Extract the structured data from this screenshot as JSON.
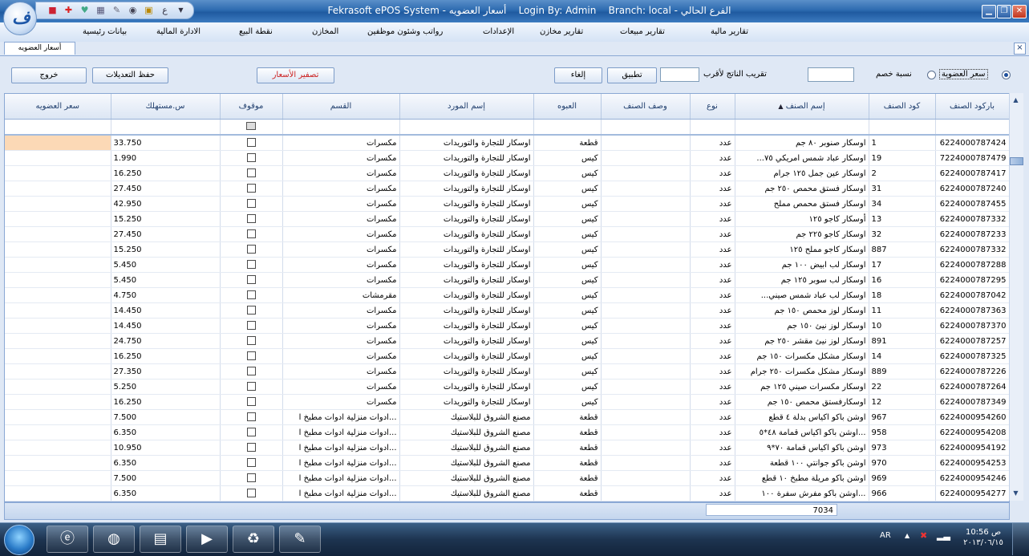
{
  "window": {
    "title": "Fekrasoft ePOS System - أسعار العضويه",
    "login": "Login By: Admin",
    "branch": "Branch: local - الفرع الحالي",
    "logo_text": "ف"
  },
  "quick_icons": [
    "apps-icon",
    "pin-icon",
    "hearts-icon",
    "calculator-icon",
    "notepad-icon",
    "eye-icon",
    "lock-icon",
    "language-icon",
    "dropdown-icon"
  ],
  "menu": [
    "تقارير مالية",
    "تقارير مبيعات",
    "تقارير مخازن",
    "الإعدادات",
    "رواتب وشئون موظفين",
    "المخازن",
    "نقطة البيع",
    "الادارة المالية",
    "بيانات رئيسية"
  ],
  "tab": {
    "label": "أسعار العضويه",
    "close": "×"
  },
  "toolbar": {
    "exit": "خروج",
    "save": "حفظ التعديلات",
    "reset": "تصفير الأسعار",
    "cancel": "إلغاء",
    "apply": "تطبيق",
    "round_label": "تقريب الناتج لأقرب",
    "discount_label": "نسبة خصم",
    "member_price_label": "سعر العضوية"
  },
  "columns": [
    "باركود الصنف",
    "كود الصنف",
    "إسم الصنف",
    "نوع",
    "وصف الصنف",
    "العبوه",
    "إسم المورد",
    "القسم",
    "موقوف",
    "س.مستهلك",
    "سعر العضويه"
  ],
  "rows": [
    [
      "6224000787424",
      "1",
      "اوسكار صنوبر ٨٠ جم",
      "عدد",
      "",
      "قطعة",
      "اوسكار للتجارة والتوريدات",
      "مكسرات",
      "33.750"
    ],
    [
      "7224000787479",
      "19",
      "اوسكار عباد شمس امريكي ٧٥...",
      "عدد",
      "",
      "كيس",
      "اوسكار للتجارة والتوريدات",
      "مكسرات",
      "1.990"
    ],
    [
      "6224000787417",
      "2",
      "اوسكار عين جمل ١٢٥ جرام",
      "عدد",
      "",
      "كيس",
      "اوسكار للتجارة والتوريدات",
      "مكسرات",
      "16.250"
    ],
    [
      "6224000787240",
      "31",
      "اوسكار فستق محمص ٢٥٠ جم",
      "عدد",
      "",
      "كيس",
      "اوسكار للتجارة والتوريدات",
      "مكسرات",
      "27.450"
    ],
    [
      "6224000787455",
      "34",
      "اوسكار فستق محمص مملح",
      "عدد",
      "",
      "كيس",
      "اوسكار للتجارة والتوريدات",
      "مكسرات",
      "42.950"
    ],
    [
      "6224000787332",
      "13",
      "أوسكار كاجو ١٢٥",
      "عدد",
      "",
      "كيس",
      "اوسكار للتجارة والتوريدات",
      "مكسرات",
      "15.250"
    ],
    [
      "6224000787233",
      "32",
      "اوسكار كاجو ٢٢٥ جم",
      "عدد",
      "",
      "كيس",
      "اوسكار للتجارة والتوريدات",
      "مكسرات",
      "27.450"
    ],
    [
      "6224000787332",
      "887",
      "اوسكار كاجو مملح ١٢٥",
      "عدد",
      "",
      "كيس",
      "اوسكار للتجارة والتوريدات",
      "مكسرات",
      "15.250"
    ],
    [
      "6224000787288",
      "17",
      "اوسكار لب ابيض ١٠٠ جم",
      "عدد",
      "",
      "كيس",
      "اوسكار للتجارة والتوريدات",
      "مكسرات",
      "5.450"
    ],
    [
      "6224000787295",
      "16",
      "اوسكار لب سوبر ١٢٥ جم",
      "عدد",
      "",
      "كيس",
      "اوسكار للتجارة والتوريدات",
      "مكسرات",
      "5.450"
    ],
    [
      "6224000787042",
      "18",
      "اوسكار لب عباد شمس صيني...",
      "عدد",
      "",
      "كيس",
      "اوسكار للتجارة والتوريدات",
      "مقرمشات",
      "4.750"
    ],
    [
      "6224000787363",
      "11",
      "اوسكار لوز محمص ١٥٠ جم",
      "عدد",
      "",
      "كيس",
      "اوسكار للتجارة والتوريدات",
      "مكسرات",
      "14.450"
    ],
    [
      "6224000787370",
      "10",
      "اوسكار لوز نيئ ١٥٠ جم",
      "عدد",
      "",
      "كيس",
      "اوسكار للتجارة والتوريدات",
      "مكسرات",
      "14.450"
    ],
    [
      "6224000787257",
      "891",
      "اوسكار لوز نيئ مقشر ٢٥٠ جم",
      "عدد",
      "",
      "كيس",
      "اوسكار للتجارة والتوريدات",
      "مكسرات",
      "24.750"
    ],
    [
      "6224000787325",
      "14",
      "اوسكار مشكل مكسرات ١٥٠ جم",
      "عدد",
      "",
      "كيس",
      "اوسكار للتجارة والتوريدات",
      "مكسرات",
      "16.250"
    ],
    [
      "6224000787226",
      "889",
      "اوسكار مشكل مكسرات ٢٥٠ جرام",
      "عدد",
      "",
      "كيس",
      "اوسكار للتجارة والتوريدات",
      "مكسرات",
      "27.350"
    ],
    [
      "6224000787264",
      "22",
      "اوسكار مكسرات صيني ١٢٥ جم",
      "عدد",
      "",
      "كيس",
      "اوسكار للتجارة والتوريدات",
      "مكسرات",
      "5.250"
    ],
    [
      "6224000787349",
      "12",
      "اوسكارفستق محمص ١٥٠ جم",
      "عدد",
      "",
      "كيس",
      "اوسكار للتجارة والتوريدات",
      "مكسرات",
      "16.250"
    ],
    [
      "6224000954260",
      "967",
      "اوشن باكو اكياس بدلة ٤ قطع",
      "عدد",
      "",
      "قطعة",
      "مصنع الشروق للبلاستيك",
      "...ادوات منزلية ادوات مطبخ ا",
      "7.500"
    ],
    [
      "6224000954208",
      "958",
      "...اوشن باكو اكياس قمامة ٤٨*٥",
      "عدد",
      "",
      "قطعة",
      "مصنع الشروق للبلاستيك",
      "...ادوات منزلية ادوات مطبخ ا",
      "6.350"
    ],
    [
      "6224000954192",
      "973",
      "اوشن باكو اكياس قمامة ٧٠*٩",
      "عدد",
      "",
      "قطعة",
      "مصنع الشروق للبلاستيك",
      "...ادوات منزلية ادوات مطبخ ا",
      "10.950"
    ],
    [
      "6224000954253",
      "970",
      "اوشن باكو جوانتي ١٠٠ قطعة",
      "عدد",
      "",
      "قطعة",
      "مصنع الشروق للبلاستيك",
      "...ادوات منزلية ادوات مطبخ ا",
      "6.350"
    ],
    [
      "6224000954246",
      "969",
      "اوشن باكو مريلة مطبخ ١٠ قطع",
      "عدد",
      "",
      "قطعة",
      "مصنع الشروق للبلاستيك",
      "...ادوات منزلية ادوات مطبخ ا",
      "7.500"
    ],
    [
      "6224000954277",
      "966",
      "...اوشن باكو مفرش سفرة ١٠٠",
      "عدد",
      "",
      "قطعة",
      "مصنع الشروق للبلاستيك",
      "...ادوات منزلية ادوات مطبخ ا",
      "6.350"
    ]
  ],
  "footer": {
    "count": "7034"
  },
  "taskbar": {
    "items": [
      "ie-icon",
      "firefox-icon",
      "explorer-icon",
      "media-icon",
      "recycle-icon",
      "paint-icon"
    ],
    "lang": "AR",
    "time": "10:56 ص",
    "date": "٢٠١٣/٠٦/١٥"
  },
  "colors": {
    "accent": "#2d6bb0",
    "highlight_cell": "#fcd9b6",
    "grid_header": "#dce6f4"
  }
}
